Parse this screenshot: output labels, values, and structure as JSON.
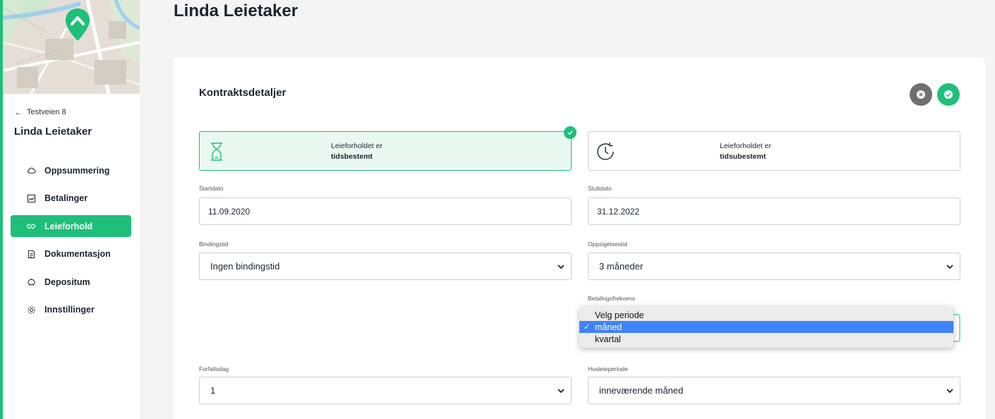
{
  "sidebar": {
    "back_link": "Testveien 8",
    "tenant_name": "Linda Leietaker",
    "items": [
      {
        "label": "Oppsummering",
        "icon": "cloud-icon"
      },
      {
        "label": "Betalinger",
        "icon": "chart-icon"
      },
      {
        "label": "Leieforhold",
        "icon": "handshake-icon",
        "active": true
      },
      {
        "label": "Dokumentasjon",
        "icon": "document-icon"
      },
      {
        "label": "Depositum",
        "icon": "piggy-bank-icon"
      },
      {
        "label": "Innstillinger",
        "icon": "gear-icon"
      }
    ]
  },
  "page": {
    "title": "Linda Leietaker"
  },
  "contract": {
    "section_title": "Kontraktsdetaljer",
    "option_fixed": {
      "line1": "Leieforholdet er",
      "line2": "tidsbestemt",
      "selected": true
    },
    "option_open": {
      "line1": "Leieforholdet er",
      "line2": "tidsubestemt",
      "selected": false
    },
    "start_date": {
      "label": "Startdato",
      "value": "11.09.2020"
    },
    "end_date": {
      "label": "Sluttdato",
      "value": "31.12.2022"
    },
    "binding": {
      "label": "Bindingstid",
      "value": "Ingen bindingstid"
    },
    "notice": {
      "label": "Oppsigelsestid",
      "value": "3 måneder"
    },
    "payment_frequency": {
      "label": "Betalingsfrekvens",
      "options": [
        "Velg periode",
        "måned",
        "kvartal"
      ],
      "selected": "måned"
    },
    "due_day": {
      "label": "Forfallsdag",
      "value": "1"
    },
    "rent_period": {
      "label": "Husleieperiode",
      "value": "inneværende måned"
    }
  },
  "colors": {
    "accent": "#1fbf7a",
    "highlight": "#3f82f7",
    "cancel": "#6f6f6f"
  }
}
